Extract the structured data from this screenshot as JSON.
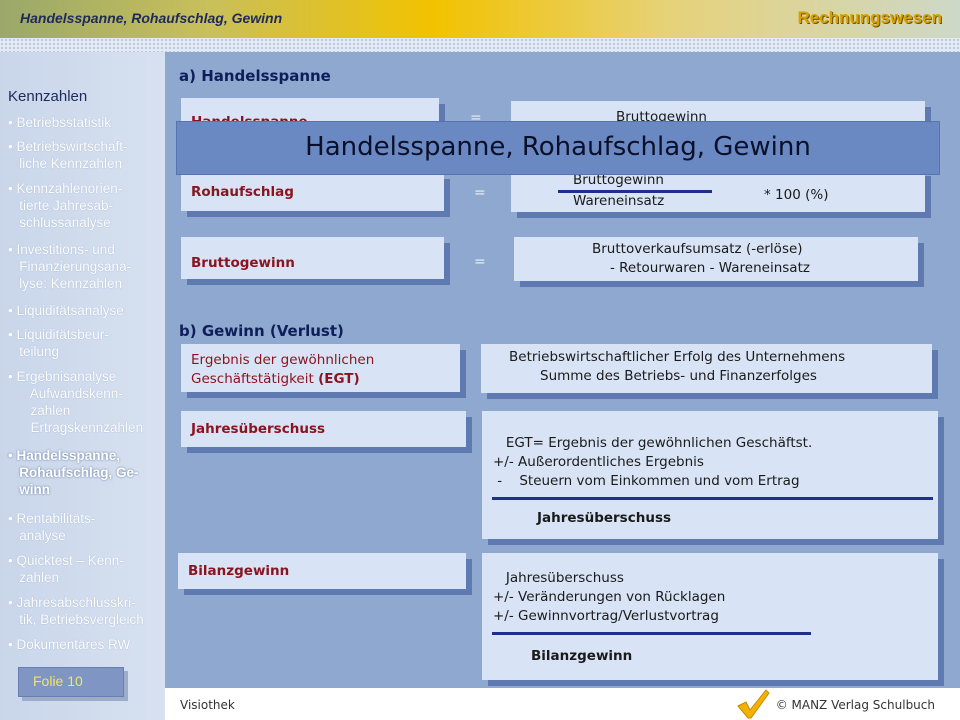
{
  "header": {
    "title": "Handelsspanne, Rohaufschlag, Gewinn",
    "brand": "Rechnungswesen"
  },
  "sidebar": {
    "title": "Kennzahlen",
    "items": [
      {
        "label": "• Betriebsstatistik"
      },
      {
        "label": "• Betriebswirtschaft-\n   liche Kennzahlen"
      },
      {
        "label": "• Kennzahlenorien-\n   tierte Jahresab-\n   schlussanalyse"
      },
      {
        "label": "• Investitions- und\n   Finanzierungsana-\n   lyse: Kennzahlen"
      },
      {
        "label": "• Liquiditätsanalyse"
      },
      {
        "label": "• Liquiditätsbeur-\n   teilung"
      },
      {
        "label": "• Ergebnisanalyse\n      Aufwandskenn-\n      zahlen\n      Ertragskennzahlen"
      },
      {
        "label": "• Handelsspanne,\n   Rohaufschlag, Ge-\n   winn"
      },
      {
        "label": "• Rentabilitäts-\n   analyse"
      },
      {
        "label": "• Quicktest – Kenn-\n   zahlen"
      },
      {
        "label": "• Jahresabschlusskri-\n   tik, Betriebsvergleich"
      },
      {
        "label": "• Dokumentäres RW"
      }
    ],
    "folie": "Folie 10"
  },
  "section_a": {
    "title": "a) Handelsspanne",
    "rows": [
      {
        "label": "Handelsspanne",
        "eq": "=",
        "numerator": "Bruttogewinn"
      },
      {
        "label": "Rohaufschlag",
        "eq": "=",
        "numerator": "Bruttogewinn",
        "denominator": "Wareneinsatz",
        "factor": "* 100 (%)"
      },
      {
        "label": "Bruttogewinn",
        "eq": "=",
        "line1": "Bruttoverkaufsumsatz (-erlöse)",
        "line2": "- Retourwaren - Wareneinsatz"
      }
    ]
  },
  "section_b": {
    "title": "b) Gewinn (Verlust)",
    "egt": {
      "label_line1": "Ergebnis der gewöhnlichen",
      "label_line2": "Geschäftstätigkeit ",
      "label_abbr": "(EGT)",
      "line1": "Betriebswirtschaftlicher Erfolg des Unternehmens",
      "line2": "Summe des Betriebs- und Finanzerfolges"
    },
    "jahresueberschuss": {
      "label": "Jahresüberschuss",
      "line1": "   EGT= Ergebnis der gewöhnlichen Geschäftst.",
      "line2": "+/- Außerordentliches Ergebnis",
      "line3": " -    Steuern vom Einkommen und vom Ertrag",
      "result": "Jahresüberschuss"
    },
    "bilanzgewinn": {
      "label": "Bilanzgewinn",
      "line1": "   Jahresüberschuss",
      "line2": "+/- Veränderungen von Rücklagen",
      "line3": "+/- Gewinnvortrag/Verlustvortrag",
      "result": "Bilanzgewinn"
    }
  },
  "overlay": {
    "title": "Handelsspanne, Rohaufschlag, Gewinn"
  },
  "footer": {
    "left": "Visiothek",
    "right": "© MANZ Verlag Schulbuch"
  }
}
